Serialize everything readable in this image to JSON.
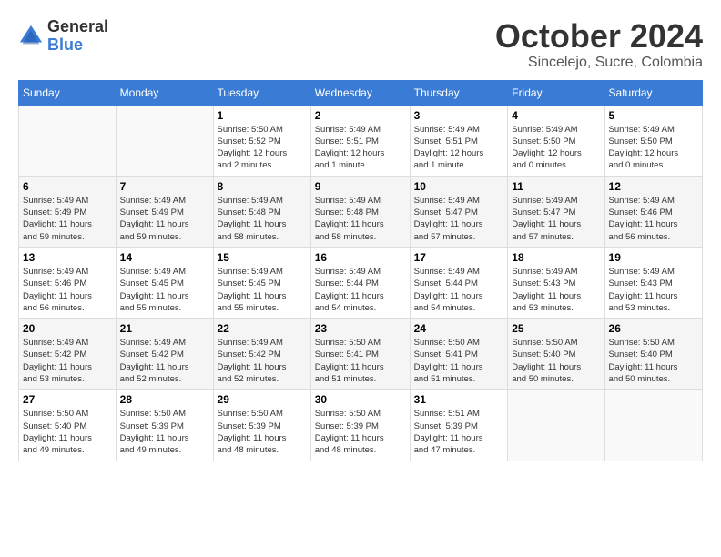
{
  "logo": {
    "general": "General",
    "blue": "Blue"
  },
  "title": "October 2024",
  "location": "Sincelejo, Sucre, Colombia",
  "days_of_week": [
    "Sunday",
    "Monday",
    "Tuesday",
    "Wednesday",
    "Thursday",
    "Friday",
    "Saturday"
  ],
  "weeks": [
    [
      {
        "day": "",
        "info": ""
      },
      {
        "day": "",
        "info": ""
      },
      {
        "day": "1",
        "info": "Sunrise: 5:50 AM\nSunset: 5:52 PM\nDaylight: 12 hours\nand 2 minutes."
      },
      {
        "day": "2",
        "info": "Sunrise: 5:49 AM\nSunset: 5:51 PM\nDaylight: 12 hours\nand 1 minute."
      },
      {
        "day": "3",
        "info": "Sunrise: 5:49 AM\nSunset: 5:51 PM\nDaylight: 12 hours\nand 1 minute."
      },
      {
        "day": "4",
        "info": "Sunrise: 5:49 AM\nSunset: 5:50 PM\nDaylight: 12 hours\nand 0 minutes."
      },
      {
        "day": "5",
        "info": "Sunrise: 5:49 AM\nSunset: 5:50 PM\nDaylight: 12 hours\nand 0 minutes."
      }
    ],
    [
      {
        "day": "6",
        "info": "Sunrise: 5:49 AM\nSunset: 5:49 PM\nDaylight: 11 hours\nand 59 minutes."
      },
      {
        "day": "7",
        "info": "Sunrise: 5:49 AM\nSunset: 5:49 PM\nDaylight: 11 hours\nand 59 minutes."
      },
      {
        "day": "8",
        "info": "Sunrise: 5:49 AM\nSunset: 5:48 PM\nDaylight: 11 hours\nand 58 minutes."
      },
      {
        "day": "9",
        "info": "Sunrise: 5:49 AM\nSunset: 5:48 PM\nDaylight: 11 hours\nand 58 minutes."
      },
      {
        "day": "10",
        "info": "Sunrise: 5:49 AM\nSunset: 5:47 PM\nDaylight: 11 hours\nand 57 minutes."
      },
      {
        "day": "11",
        "info": "Sunrise: 5:49 AM\nSunset: 5:47 PM\nDaylight: 11 hours\nand 57 minutes."
      },
      {
        "day": "12",
        "info": "Sunrise: 5:49 AM\nSunset: 5:46 PM\nDaylight: 11 hours\nand 56 minutes."
      }
    ],
    [
      {
        "day": "13",
        "info": "Sunrise: 5:49 AM\nSunset: 5:46 PM\nDaylight: 11 hours\nand 56 minutes."
      },
      {
        "day": "14",
        "info": "Sunrise: 5:49 AM\nSunset: 5:45 PM\nDaylight: 11 hours\nand 55 minutes."
      },
      {
        "day": "15",
        "info": "Sunrise: 5:49 AM\nSunset: 5:45 PM\nDaylight: 11 hours\nand 55 minutes."
      },
      {
        "day": "16",
        "info": "Sunrise: 5:49 AM\nSunset: 5:44 PM\nDaylight: 11 hours\nand 54 minutes."
      },
      {
        "day": "17",
        "info": "Sunrise: 5:49 AM\nSunset: 5:44 PM\nDaylight: 11 hours\nand 54 minutes."
      },
      {
        "day": "18",
        "info": "Sunrise: 5:49 AM\nSunset: 5:43 PM\nDaylight: 11 hours\nand 53 minutes."
      },
      {
        "day": "19",
        "info": "Sunrise: 5:49 AM\nSunset: 5:43 PM\nDaylight: 11 hours\nand 53 minutes."
      }
    ],
    [
      {
        "day": "20",
        "info": "Sunrise: 5:49 AM\nSunset: 5:42 PM\nDaylight: 11 hours\nand 53 minutes."
      },
      {
        "day": "21",
        "info": "Sunrise: 5:49 AM\nSunset: 5:42 PM\nDaylight: 11 hours\nand 52 minutes."
      },
      {
        "day": "22",
        "info": "Sunrise: 5:49 AM\nSunset: 5:42 PM\nDaylight: 11 hours\nand 52 minutes."
      },
      {
        "day": "23",
        "info": "Sunrise: 5:50 AM\nSunset: 5:41 PM\nDaylight: 11 hours\nand 51 minutes."
      },
      {
        "day": "24",
        "info": "Sunrise: 5:50 AM\nSunset: 5:41 PM\nDaylight: 11 hours\nand 51 minutes."
      },
      {
        "day": "25",
        "info": "Sunrise: 5:50 AM\nSunset: 5:40 PM\nDaylight: 11 hours\nand 50 minutes."
      },
      {
        "day": "26",
        "info": "Sunrise: 5:50 AM\nSunset: 5:40 PM\nDaylight: 11 hours\nand 50 minutes."
      }
    ],
    [
      {
        "day": "27",
        "info": "Sunrise: 5:50 AM\nSunset: 5:40 PM\nDaylight: 11 hours\nand 49 minutes."
      },
      {
        "day": "28",
        "info": "Sunrise: 5:50 AM\nSunset: 5:39 PM\nDaylight: 11 hours\nand 49 minutes."
      },
      {
        "day": "29",
        "info": "Sunrise: 5:50 AM\nSunset: 5:39 PM\nDaylight: 11 hours\nand 48 minutes."
      },
      {
        "day": "30",
        "info": "Sunrise: 5:50 AM\nSunset: 5:39 PM\nDaylight: 11 hours\nand 48 minutes."
      },
      {
        "day": "31",
        "info": "Sunrise: 5:51 AM\nSunset: 5:39 PM\nDaylight: 11 hours\nand 47 minutes."
      },
      {
        "day": "",
        "info": ""
      },
      {
        "day": "",
        "info": ""
      }
    ]
  ]
}
